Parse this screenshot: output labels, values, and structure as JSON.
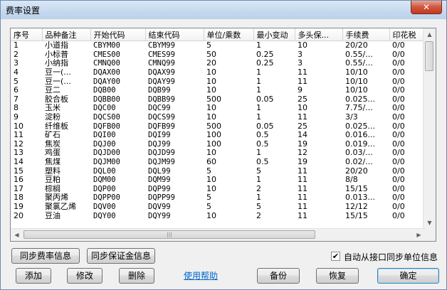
{
  "window": {
    "title": "费率设置",
    "close_label": "✕"
  },
  "grid": {
    "columns": [
      "序号",
      "品种备注",
      "开始代码",
      "结束代码",
      "单位/乘数",
      "最小变动",
      "多头保...",
      "手续费",
      "印花税"
    ],
    "rows": [
      [
        "1",
        "小道指",
        "CBYM00",
        "CBYM99",
        "5",
        "1",
        "10",
        "20/20",
        "0/0"
      ],
      [
        "2",
        "小标普",
        "CMES00",
        "CMES99",
        "50",
        "0.25",
        "3",
        "0.55/...",
        "0/0"
      ],
      [
        "3",
        "小纳指",
        "CMNQ00",
        "CMNQ99",
        "20",
        "0.25",
        "3",
        "0.55/...",
        "0/0"
      ],
      [
        "4",
        "豆一(...",
        "DQAX00",
        "DQAX99",
        "10",
        "1",
        "11",
        "10/10",
        "0/0"
      ],
      [
        "5",
        "豆一(...",
        "DQAY00",
        "DQAY99",
        "10",
        "1",
        "11",
        "10/10",
        "0/0"
      ],
      [
        "6",
        "豆二",
        "DQB00",
        "DQB99",
        "10",
        "1",
        "9",
        "10/10",
        "0/0"
      ],
      [
        "7",
        "胶合板",
        "DQBB00",
        "DQBB99",
        "500",
        "0.05",
        "25",
        "0.025...",
        "0/0"
      ],
      [
        "8",
        "玉米",
        "DQC00",
        "DQC99",
        "10",
        "1",
        "10",
        "7.75/...",
        "0/0"
      ],
      [
        "9",
        "淀粉",
        "DQCS00",
        "DQCS99",
        "10",
        "1",
        "11",
        "3/3",
        "0/0"
      ],
      [
        "10",
        "纤维板",
        "DQFB00",
        "DQFB99",
        "500",
        "0.05",
        "25",
        "0.025...",
        "0/0"
      ],
      [
        "11",
        "矿石",
        "DQI00",
        "DQI99",
        "100",
        "0.5",
        "14",
        "0.016...",
        "0/0"
      ],
      [
        "12",
        "焦炭",
        "DQJ00",
        "DQJ99",
        "100",
        "0.5",
        "19",
        "0.019...",
        "0/0"
      ],
      [
        "13",
        "鸡蛋",
        "DQJD00",
        "DQJD99",
        "10",
        "1",
        "12",
        "0.03/...",
        "0/0"
      ],
      [
        "14",
        "焦煤",
        "DQJM00",
        "DQJM99",
        "60",
        "0.5",
        "19",
        "0.02/...",
        "0/0"
      ],
      [
        "15",
        "塑料",
        "DQL00",
        "DQL99",
        "5",
        "5",
        "11",
        "20/20",
        "0/0"
      ],
      [
        "16",
        "豆粕",
        "DQM00",
        "DQM99",
        "10",
        "1",
        "11",
        "8/8",
        "0/0"
      ],
      [
        "17",
        "棕榈",
        "DQP00",
        "DQP99",
        "10",
        "2",
        "11",
        "15/15",
        "0/0"
      ],
      [
        "18",
        "聚丙烯",
        "DQPP00",
        "DQPP99",
        "5",
        "1",
        "11",
        "0.013...",
        "0/0"
      ],
      [
        "19",
        "聚氯乙烯",
        "DQV00",
        "DQV99",
        "5",
        "5",
        "11",
        "12/12",
        "0/0"
      ],
      [
        "20",
        "豆油",
        "DQY00",
        "DQY99",
        "10",
        "2",
        "11",
        "15/15",
        "0/0"
      ]
    ]
  },
  "buttons": {
    "sync_fee": "同步费率信息",
    "sync_margin": "同步保证金信息",
    "add": "添加",
    "modify": "修改",
    "delete": "删除",
    "help": "使用帮助",
    "backup": "备份",
    "restore": "恢复",
    "ok": "确定"
  },
  "options": {
    "auto_sync_label": "自动从接口同步单位信息",
    "auto_sync_checked": true,
    "check_mark": "✔"
  },
  "icons": {
    "scroll_up": "▲",
    "scroll_down": "▼",
    "scroll_left": "◀",
    "scroll_right": "▶",
    "grip": "|||"
  }
}
